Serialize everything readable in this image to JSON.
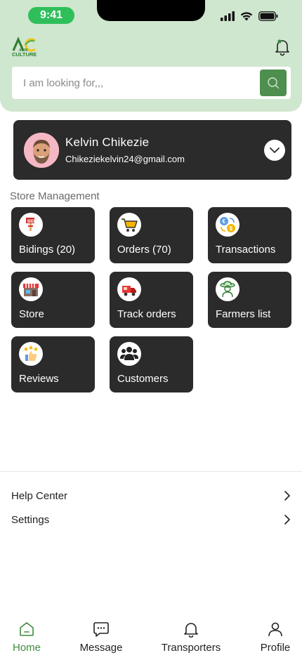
{
  "status_bar": {
    "time": "9:41"
  },
  "header": {
    "logo_text": "AGRICULTURE",
    "search_placeholder": "I am looking for,,,"
  },
  "profile": {
    "name": "Kelvin Chikezie",
    "email": "Chikeziekelvin24@gmail.com"
  },
  "store_management": {
    "title": "Store Management",
    "tiles": [
      {
        "label": "Bidings (20)",
        "icon": "auction-icon"
      },
      {
        "label": "Orders (70)",
        "icon": "cart-icon"
      },
      {
        "label": "Transactions",
        "icon": "exchange-icon"
      },
      {
        "label": "Store",
        "icon": "store-icon"
      },
      {
        "label": "Track orders",
        "icon": "delivery-truck-icon"
      },
      {
        "label": "Farmers list",
        "icon": "farmer-icon"
      },
      {
        "label": "Reviews",
        "icon": "thumbs-up-icon"
      },
      {
        "label": "Customers",
        "icon": "users-icon"
      }
    ]
  },
  "menu": {
    "help_center": "Help Center",
    "settings": "Settings"
  },
  "bottom_nav": {
    "home": "Home",
    "message": "Message",
    "transporters": "Transporters",
    "profile": "Profile"
  },
  "colors": {
    "header_bg": "#cfe6cf",
    "accent_green": "#4e8e4e",
    "card_dark": "#2b2b2b",
    "active_nav": "#3e8a3e"
  }
}
